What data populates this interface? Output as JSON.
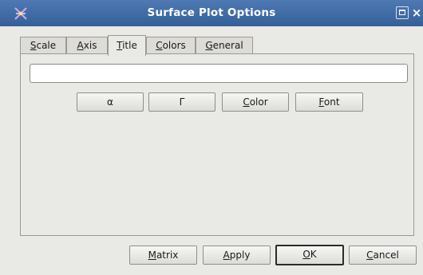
{
  "window": {
    "title": "Surface Plot Options",
    "icons": {
      "app": "app-logo-icon",
      "maximize": "maximize-icon",
      "close": "close-icon"
    },
    "close_glyph": "×"
  },
  "tabs": [
    {
      "pre": "",
      "ul": "S",
      "post": "cale",
      "name": "Scale"
    },
    {
      "pre": "",
      "ul": "A",
      "post": "xis",
      "name": "Axis"
    },
    {
      "pre": "",
      "ul": "T",
      "post": "itle",
      "name": "Title",
      "active": true
    },
    {
      "pre": "",
      "ul": "C",
      "post": "olors",
      "name": "Colors"
    },
    {
      "pre": "",
      "ul": "G",
      "post": "eneral",
      "name": "General"
    }
  ],
  "title_tab": {
    "input_value": "",
    "buttons": {
      "alpha": "α",
      "gamma": "Γ",
      "color": {
        "pre": "",
        "ul": "C",
        "post": "olor"
      },
      "font": {
        "pre": "",
        "ul": "F",
        "post": "ont"
      }
    }
  },
  "footer": {
    "matrix": {
      "pre": "",
      "ul": "M",
      "post": "atrix"
    },
    "apply": {
      "pre": "",
      "ul": "A",
      "post": "pply"
    },
    "ok": {
      "pre": "",
      "ul": "O",
      "post": "K"
    },
    "cancel": {
      "pre": "",
      "ul": "C",
      "post": "ancel"
    }
  },
  "colors": {
    "titlebar_top": "#4f79b3",
    "titlebar_bottom": "#355f97",
    "dialog_bg": "#e9e9e6"
  }
}
